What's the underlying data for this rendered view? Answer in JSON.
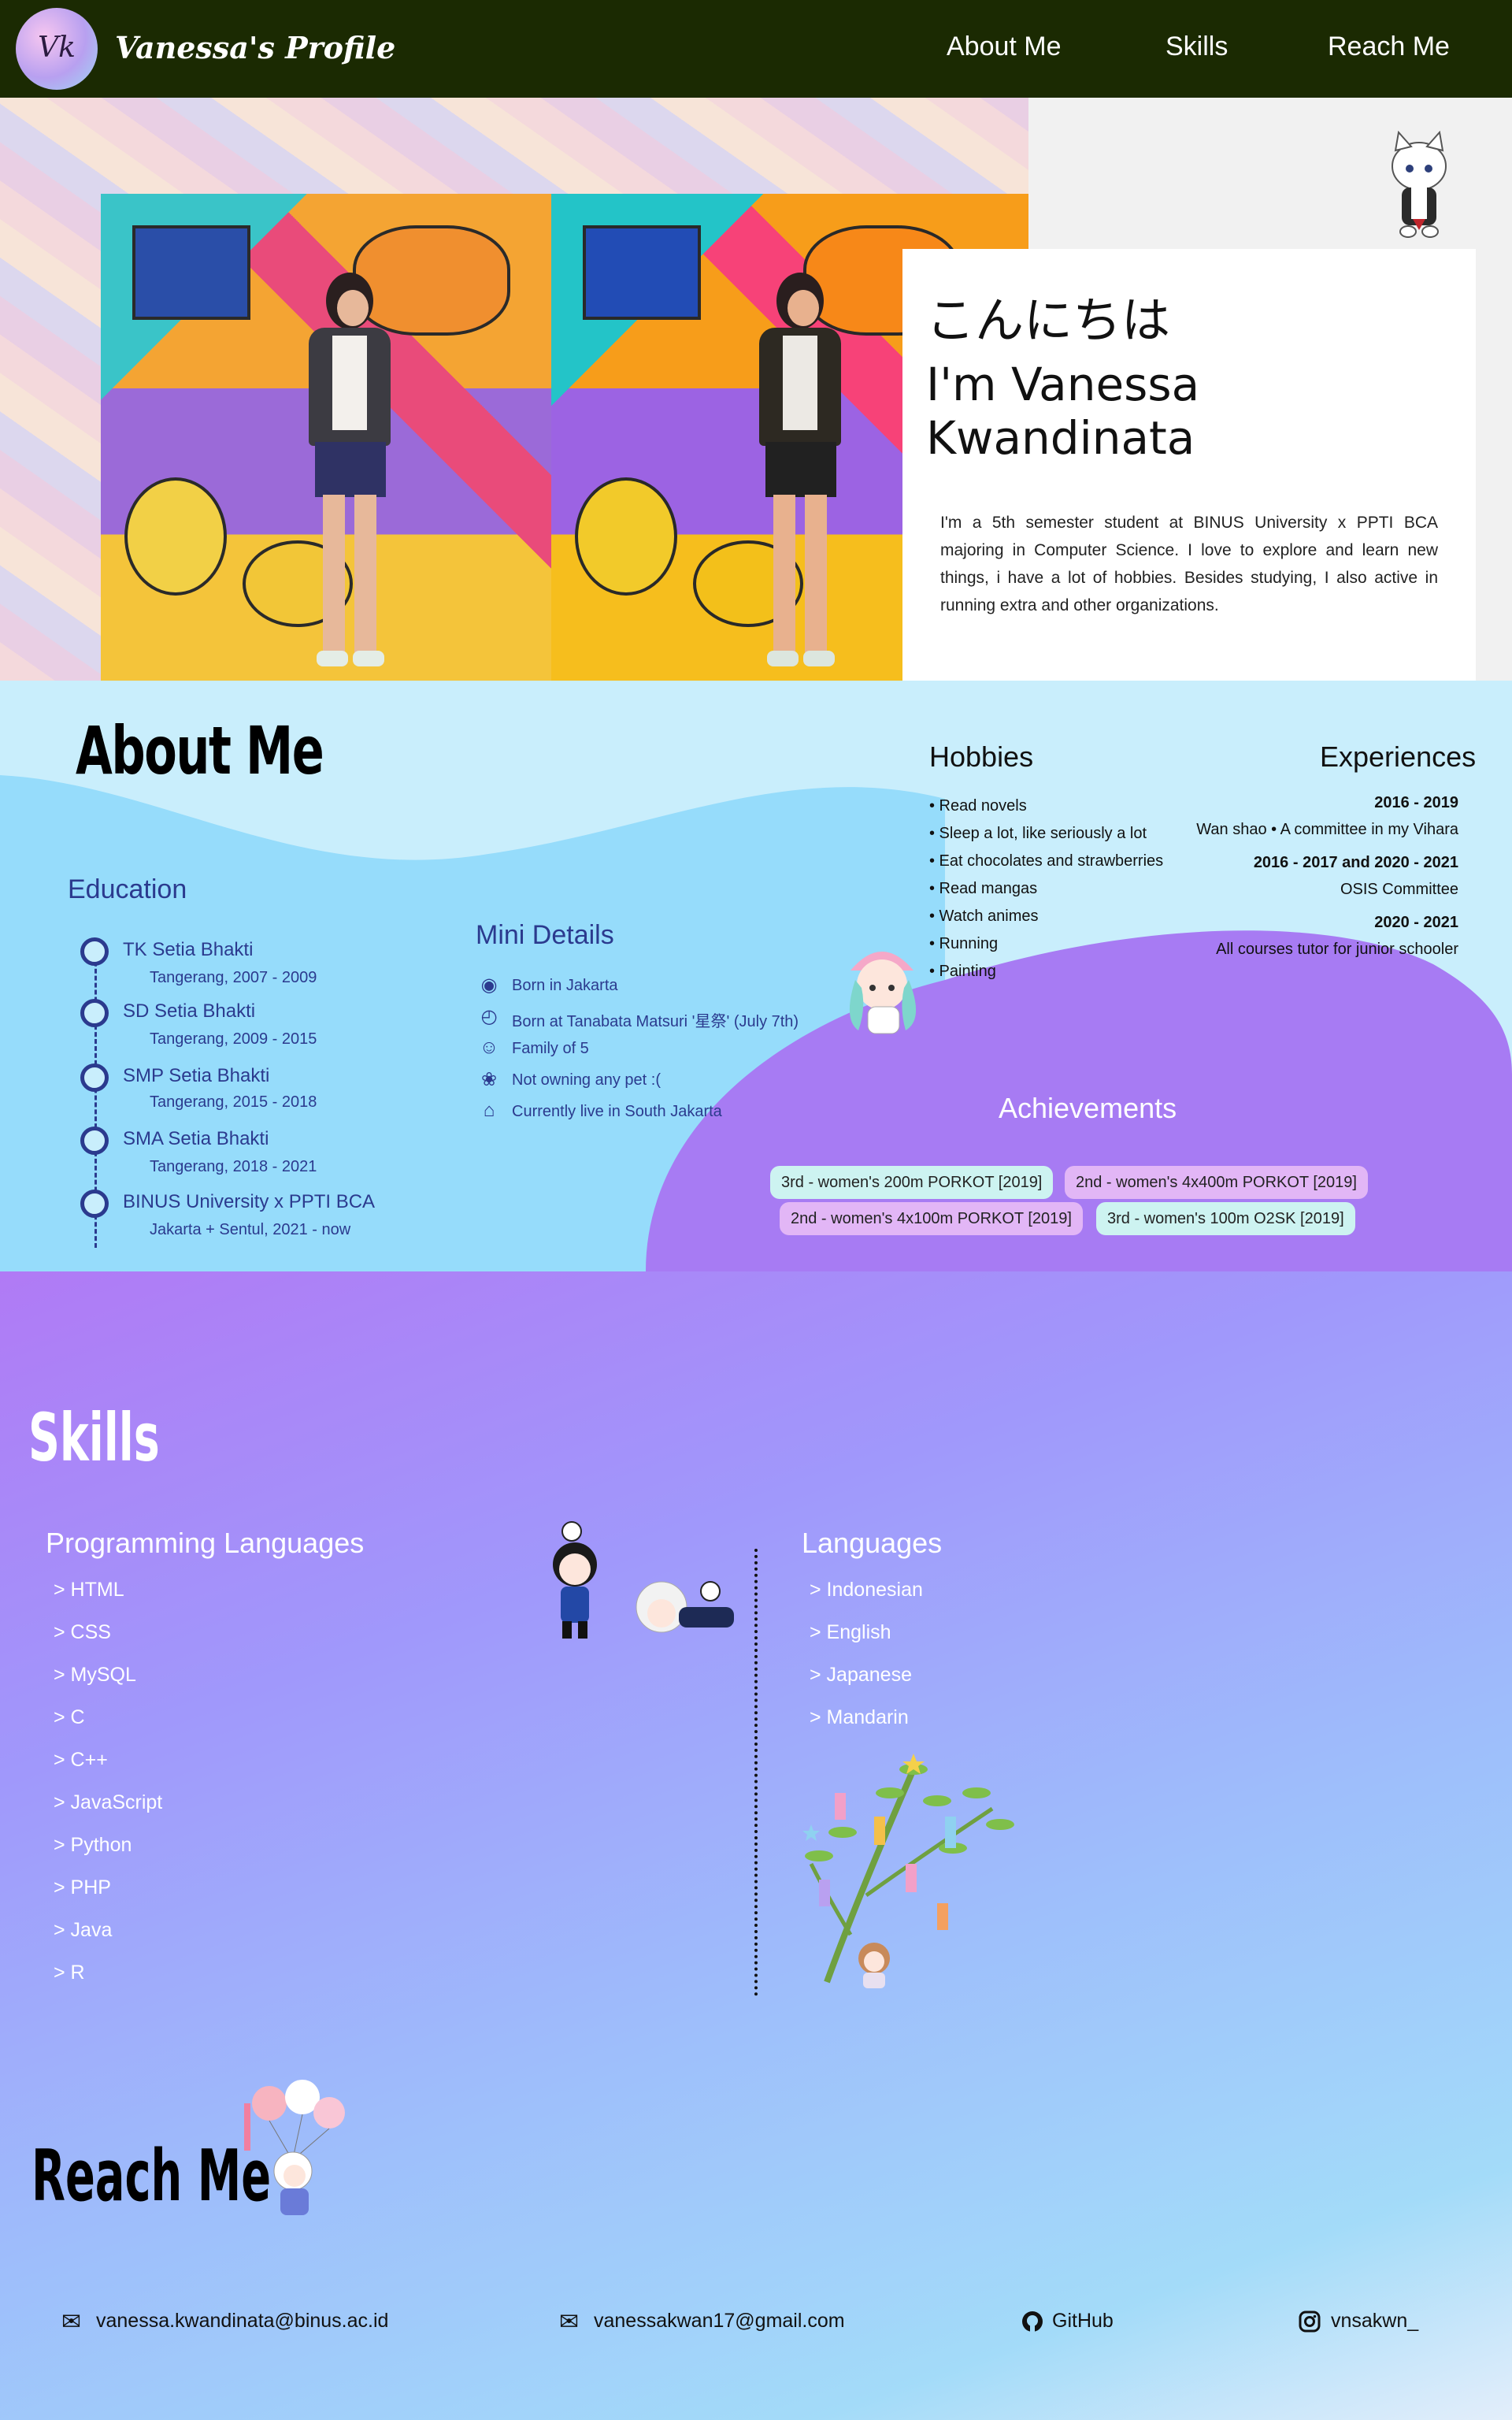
{
  "nav": {
    "logo_text": "Vk",
    "brand": "Vanessa's Profile",
    "links": [
      "About Me",
      "Skills",
      "Reach Me"
    ]
  },
  "hero": {
    "greeting": "こんにちは",
    "name": "I'm Vanessa Kwandinata",
    "intro": "I'm a 5th semester student at BINUS University x PPTI BCA majoring in Computer Science. I love to explore and learn new things, i have a lot of hobbies. Besides studying, I also active in running extra and other organizations."
  },
  "about": {
    "title": "About Me",
    "education_title": "Education",
    "education": [
      {
        "name": "TK Setia Bhakti",
        "sub": "Tangerang, 2007 - 2009"
      },
      {
        "name": "SD Setia Bhakti",
        "sub": "Tangerang, 2009 - 2015"
      },
      {
        "name": "SMP Setia Bhakti",
        "sub": "Tangerang, 2015 - 2018"
      },
      {
        "name": "SMA Setia Bhakti",
        "sub": "Tangerang, 2018 - 2021"
      },
      {
        "name": "BINUS University x PPTI BCA",
        "sub": "Jakarta + Sentul, 2021 - now"
      }
    ],
    "mini_title": "Mini Details",
    "mini": [
      {
        "icon": "map-pin-icon",
        "text": "Born in Jakarta"
      },
      {
        "icon": "clock-icon",
        "text": "Born at Tanabata Matsuri '星祭' (July 7th)"
      },
      {
        "icon": "users-icon",
        "text": "Family of 5"
      },
      {
        "icon": "paw-icon",
        "text": "Not owning any pet :("
      },
      {
        "icon": "home-icon",
        "text": "Currently live in South Jakarta"
      }
    ],
    "hobbies_title": "Hobbies",
    "hobbies": [
      "• Read novels",
      "• Sleep a lot, like seriously a lot",
      "• Eat chocolates and strawberries",
      "• Read mangas",
      "• Watch animes",
      "• Running",
      "• Painting"
    ],
    "experiences_title": "Experiences",
    "experiences": [
      {
        "year": "2016 - 2019",
        "desc": "Wan shao • A committee in my Vihara"
      },
      {
        "year": "2016 - 2017 and 2020 - 2021",
        "desc": "OSIS Committee"
      },
      {
        "year": "2020 - 2021",
        "desc": "All courses tutor for junior schooler"
      }
    ],
    "achievements_title": "Achievements",
    "achievements": [
      "3rd - women's 200m PORKOT [2019]",
      "2nd - women's 4x400m PORKOT [2019]",
      "2nd - women's 4x100m PORKOT [2019]",
      "3rd - women's 100m O2SK [2019]"
    ]
  },
  "skills": {
    "title": "Skills",
    "programming_title": "Programming Languages",
    "programming": [
      "> HTML",
      "> CSS",
      "> MySQL",
      "> C",
      "> C++",
      "> JavaScript",
      "> Python",
      "> PHP",
      "> Java",
      "> R"
    ],
    "languages_title": "Languages",
    "languages": [
      "> Indonesian",
      "> English",
      "> Japanese",
      "> Mandarin"
    ]
  },
  "reach": {
    "title": "Reach Me",
    "contacts": [
      {
        "icon": "mail-icon",
        "text": "vanessa.kwandinata@binus.ac.id"
      },
      {
        "icon": "mail-icon",
        "text": "vanessakwan17@gmail.com"
      },
      {
        "icon": "github-icon",
        "text": "GitHub"
      },
      {
        "icon": "instagram-icon",
        "text": "vnsakwn_"
      }
    ]
  },
  "colors": {
    "nav_bg": "#1b2a02",
    "navy": "#2b3a8e",
    "purple": "#a77bf3",
    "light_blue": "#c9eefc"
  }
}
